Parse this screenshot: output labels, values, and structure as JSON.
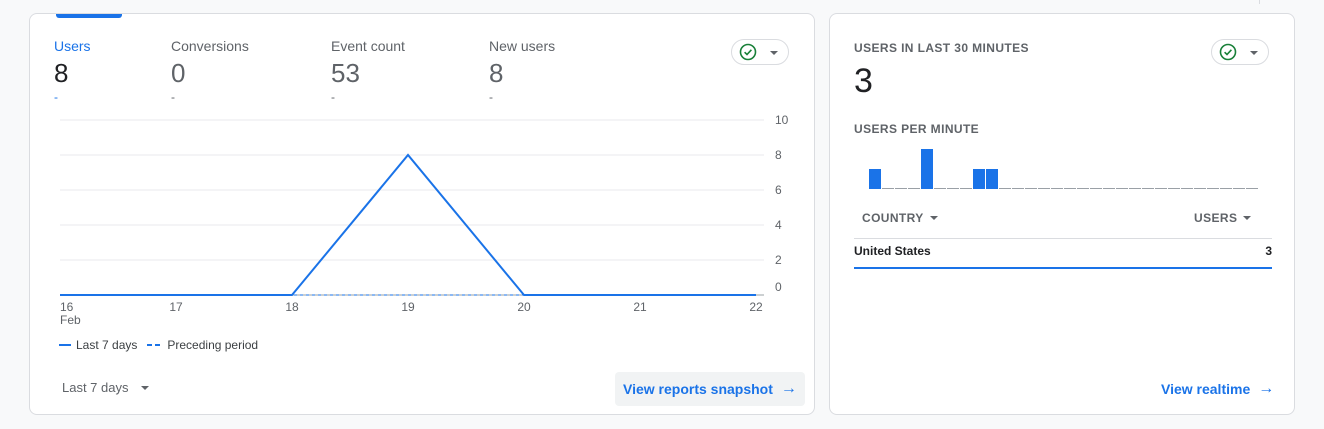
{
  "overview": {
    "metrics": [
      {
        "label": "Users",
        "value": "8",
        "delta": "-"
      },
      {
        "label": "Conversions",
        "value": "0",
        "delta": "-"
      },
      {
        "label": "Event count",
        "value": "53",
        "delta": "-"
      },
      {
        "label": "New users",
        "value": "8",
        "delta": "-"
      }
    ],
    "legend": {
      "current": "Last 7 days",
      "previous": "Preceding period"
    },
    "date_range": "Last 7 days",
    "snapshot_link": "View reports snapshot",
    "icons": {
      "status": "check-circle-icon",
      "dropdown": "caret-down-icon",
      "arrow": "arrow-right-icon"
    }
  },
  "chart_data": {
    "type": "line",
    "x": [
      "16",
      "17",
      "18",
      "19",
      "20",
      "21",
      "22"
    ],
    "x_sublabel": "Feb",
    "series": [
      {
        "name": "Last 7 days",
        "values": [
          0,
          0,
          0,
          8,
          0,
          0,
          0
        ],
        "style": "solid"
      },
      {
        "name": "Preceding period",
        "values": [
          0,
          0,
          0,
          0,
          0,
          0,
          0
        ],
        "style": "dashed"
      }
    ],
    "y_ticks": [
      0,
      2,
      4,
      6,
      8,
      10
    ],
    "ylim": [
      0,
      10
    ],
    "y_axis_side": "right",
    "grid": true,
    "legend_position": "bottom-left",
    "color": "#1a73e8"
  },
  "realtime": {
    "title": "USERS IN LAST 30 MINUTES",
    "value": "3",
    "subtitle": "USERS PER MINUTE",
    "per_minute": [
      1,
      0,
      0,
      0,
      2,
      0,
      0,
      0,
      1,
      1,
      0,
      0,
      0,
      0,
      0,
      0,
      0,
      0,
      0,
      0,
      0,
      0,
      0,
      0,
      0,
      0,
      0,
      0,
      0,
      0
    ],
    "columns": {
      "country": "COUNTRY",
      "users": "USERS"
    },
    "rows": [
      {
        "country": "United States",
        "users": "3"
      }
    ],
    "realtime_link": "View realtime"
  },
  "colors": {
    "accent": "#1a73e8",
    "success": "#188038",
    "muted": "#5f6368",
    "border": "#dadce0"
  }
}
